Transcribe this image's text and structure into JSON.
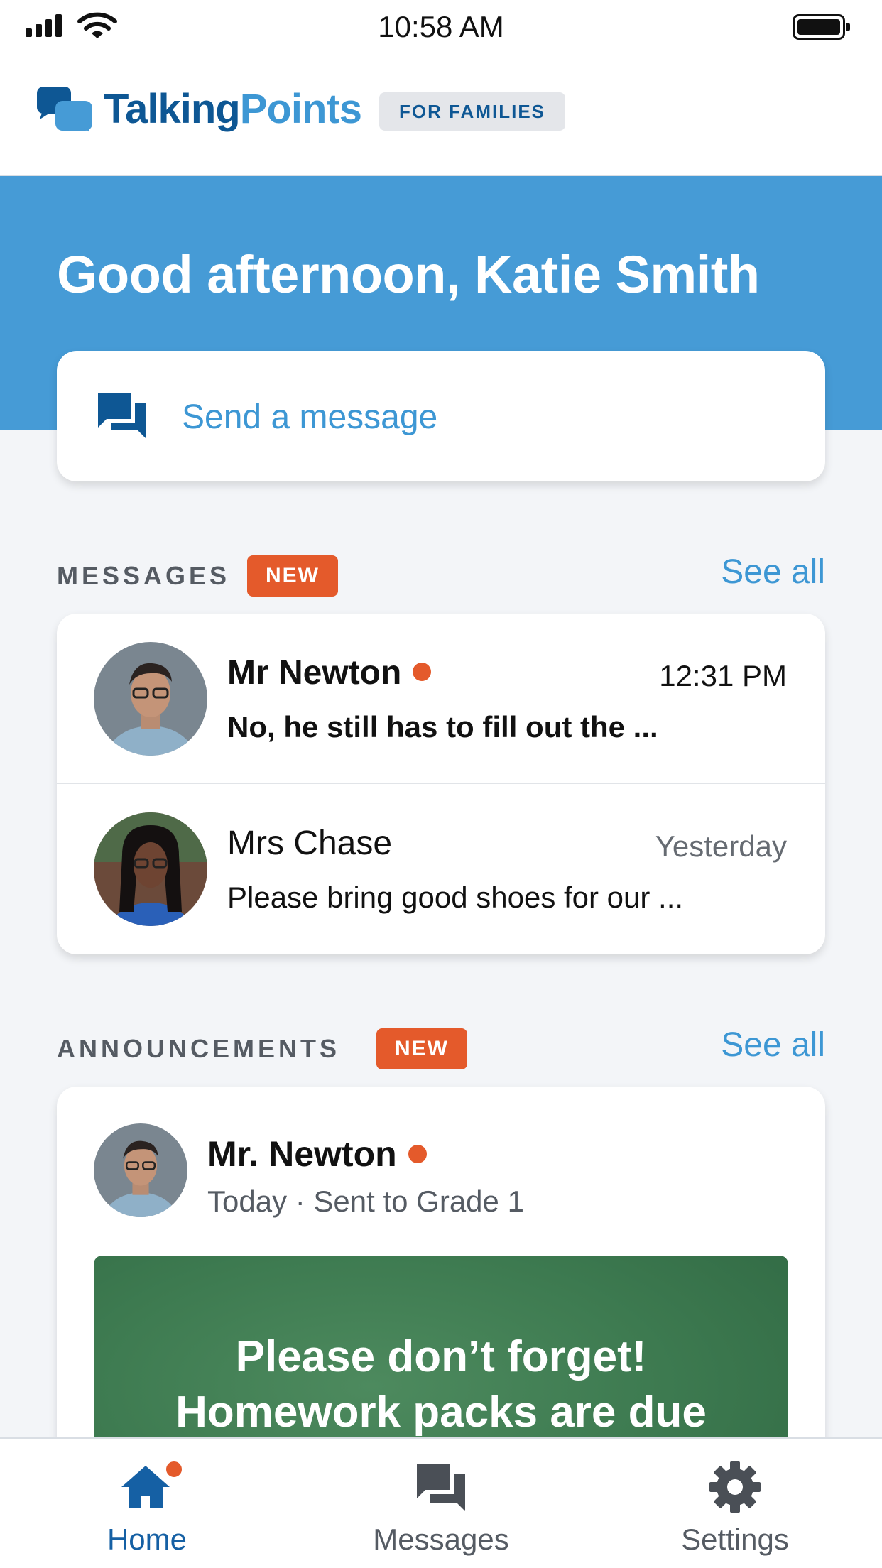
{
  "status_bar": {
    "time": "10:58 AM"
  },
  "header": {
    "logo_part1": "Talking",
    "logo_part2": "Points",
    "badge": "FOR FAMILIES"
  },
  "hero": {
    "greeting": "Good afternoon, Katie Smith",
    "send_message_label": "Send a message"
  },
  "messages_section": {
    "title": "MESSAGES",
    "badge": "NEW",
    "see_all": "See all",
    "items": [
      {
        "name": "Mr Newton",
        "time": "12:31 PM",
        "preview": "No, he still has to fill out the ...",
        "unread": true
      },
      {
        "name": "Mrs Chase",
        "time": "Yesterday",
        "preview": "Please bring good shoes for our ...",
        "unread": false
      }
    ]
  },
  "announcements_section": {
    "title": "ANNOUNCEMENTS",
    "badge": "NEW",
    "see_all": "See all",
    "item": {
      "name": "Mr. Newton",
      "meta": "Today · Sent to Grade 1",
      "image_text_line1": "Please don’t forget!",
      "image_text_line2": "Homework packs are due"
    }
  },
  "tabbar": {
    "tabs": [
      {
        "label": "Home",
        "icon": "home-icon",
        "active": true
      },
      {
        "label": "Messages",
        "icon": "chat-icon",
        "active": false
      },
      {
        "label": "Settings",
        "icon": "gear-icon",
        "active": false
      }
    ]
  },
  "colors": {
    "brand_blue": "#469bd6",
    "brand_dark_blue": "#0e5794",
    "accent_orange": "#e45a2b",
    "chalkboard_green": "#3d7a50"
  }
}
